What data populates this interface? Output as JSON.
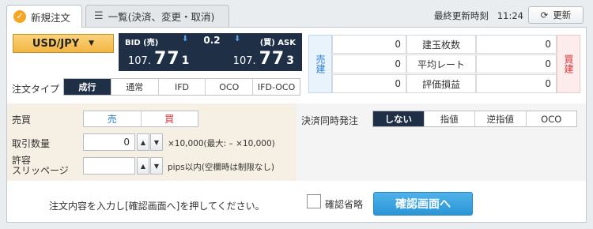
{
  "tabs": {
    "new_order": "新規注文",
    "list": "一覧(決済、変更・取消)"
  },
  "header": {
    "last_update_label": "最終更新時刻",
    "last_update_time": "11:24",
    "refresh_label": "更新"
  },
  "symbol": "USD/JPY",
  "quote": {
    "bid_label": "BID (売)",
    "ask_label": "(買) ASK",
    "spread": "0.2",
    "bid_prefix": "107.",
    "bid_big": "77",
    "bid_last": "1",
    "ask_prefix": "107.",
    "ask_big": "77",
    "ask_last": "3"
  },
  "order_type": {
    "label": "注文タイプ",
    "options": [
      "成行",
      "通常",
      "IFD",
      "OCO",
      "IFD-OCO"
    ],
    "selected": "成行"
  },
  "position_summary": {
    "sell_side": "売建",
    "buy_side": "買建",
    "rows": [
      {
        "label": "建玉枚数",
        "sell": "0",
        "buy": "0"
      },
      {
        "label": "平均レート",
        "sell": "0",
        "buy": "0"
      },
      {
        "label": "評価損益",
        "sell": "0",
        "buy": "0"
      }
    ]
  },
  "form": {
    "side_label": "売買",
    "sell": "売",
    "buy": "買",
    "quantity_label": "取引数量",
    "quantity_value": "0",
    "quantity_hint": "×10,000(最大: – ×10,000)",
    "slippage_label_1": "許容",
    "slippage_label_2": "スリッページ",
    "slippage_value": "",
    "slippage_hint": "pips以内(空欄時は制限なし)",
    "settle_label": "決済同時発注",
    "settle_options": [
      "しない",
      "指値",
      "逆指値",
      "OCO"
    ],
    "settle_selected": "しない"
  },
  "footer": {
    "instruction": "注文内容を入力し[確認画面へ]を押してください。",
    "skip_confirm": "確認省略",
    "confirm_button": "確認画面へ"
  },
  "colors": {
    "navy": "#1f2f46",
    "accent_orange": "#f5a623",
    "sell_blue": "#2b7fd3",
    "buy_red": "#d8353a",
    "confirm_blue": "#2b95d6"
  }
}
